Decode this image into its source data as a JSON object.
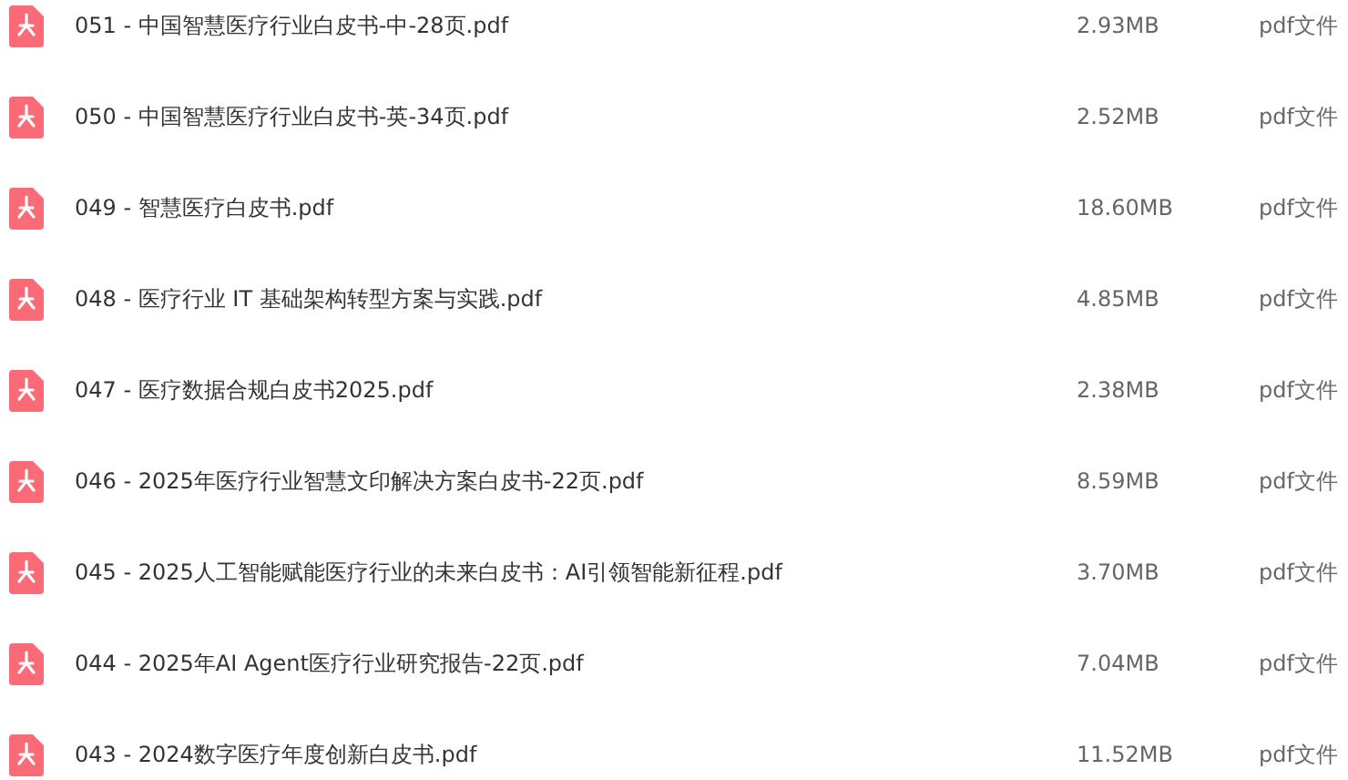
{
  "files": [
    {
      "name": "051 - 中国智慧医疗行业白皮书-中-28页.pdf",
      "size": "2.93MB",
      "type": "pdf文件"
    },
    {
      "name": "050 - 中国智慧医疗行业白皮书-英-34页.pdf",
      "size": "2.52MB",
      "type": "pdf文件"
    },
    {
      "name": "049 - 智慧医疗白皮书.pdf",
      "size": "18.60MB",
      "type": "pdf文件"
    },
    {
      "name": "048 - 医疗行业 IT 基础架构转型方案与实践.pdf",
      "size": "4.85MB",
      "type": "pdf文件"
    },
    {
      "name": "047 - 医疗数据合规白皮书2025.pdf",
      "size": "2.38MB",
      "type": "pdf文件"
    },
    {
      "name": "046 - 2025年医疗行业智慧文印解决方案白皮书-22页.pdf",
      "size": "8.59MB",
      "type": "pdf文件"
    },
    {
      "name": "045 - 2025人工智能赋能医疗行业的未来白皮书：AI引领智能新征程.pdf",
      "size": "3.70MB",
      "type": "pdf文件"
    },
    {
      "name": "044 - 2025年AI Agent医疗行业研究报告-22页.pdf",
      "size": "7.04MB",
      "type": "pdf文件"
    },
    {
      "name": "043 - 2024数字医疗年度创新白皮书.pdf",
      "size": "11.52MB",
      "type": "pdf文件"
    }
  ]
}
